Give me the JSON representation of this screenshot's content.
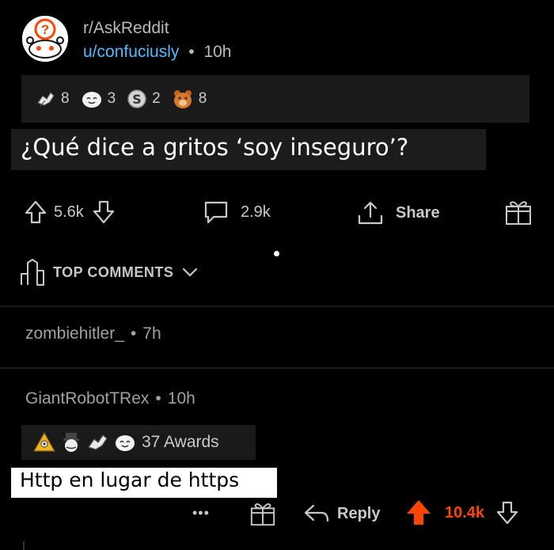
{
  "post": {
    "subreddit": "r/AskReddit",
    "username": "u/confuciusly",
    "separator": "•",
    "age": "10h",
    "awards": [
      {
        "icon": "hands-award-icon",
        "count": "8"
      },
      {
        "icon": "wholesome-face-icon",
        "count": "3"
      },
      {
        "icon": "silver-coin-icon",
        "count": "2"
      },
      {
        "icon": "bear-award-icon",
        "count": "8"
      }
    ],
    "title": "¿Qué dice a gritos ‘soy inseguro’?",
    "upvotes": "5.6k",
    "comments": "2.9k",
    "share_label": "Share"
  },
  "top_comments": {
    "label": "TOP COMMENTS"
  },
  "comments": [
    {
      "author": "zombiehitler_",
      "separator": "•",
      "age": "7h"
    },
    {
      "author": "GiantRobotTRex",
      "separator": "•",
      "age": "10h",
      "awards_label": "37 Awards",
      "body": "Http en lugar de https",
      "more": "•••",
      "reply_label": "Reply",
      "score": "10.4k",
      "score_color": "#ff4500"
    }
  ],
  "colors": {
    "background": "#000000",
    "username": "#4fbcff",
    "upvote_active": "#ff4500"
  }
}
